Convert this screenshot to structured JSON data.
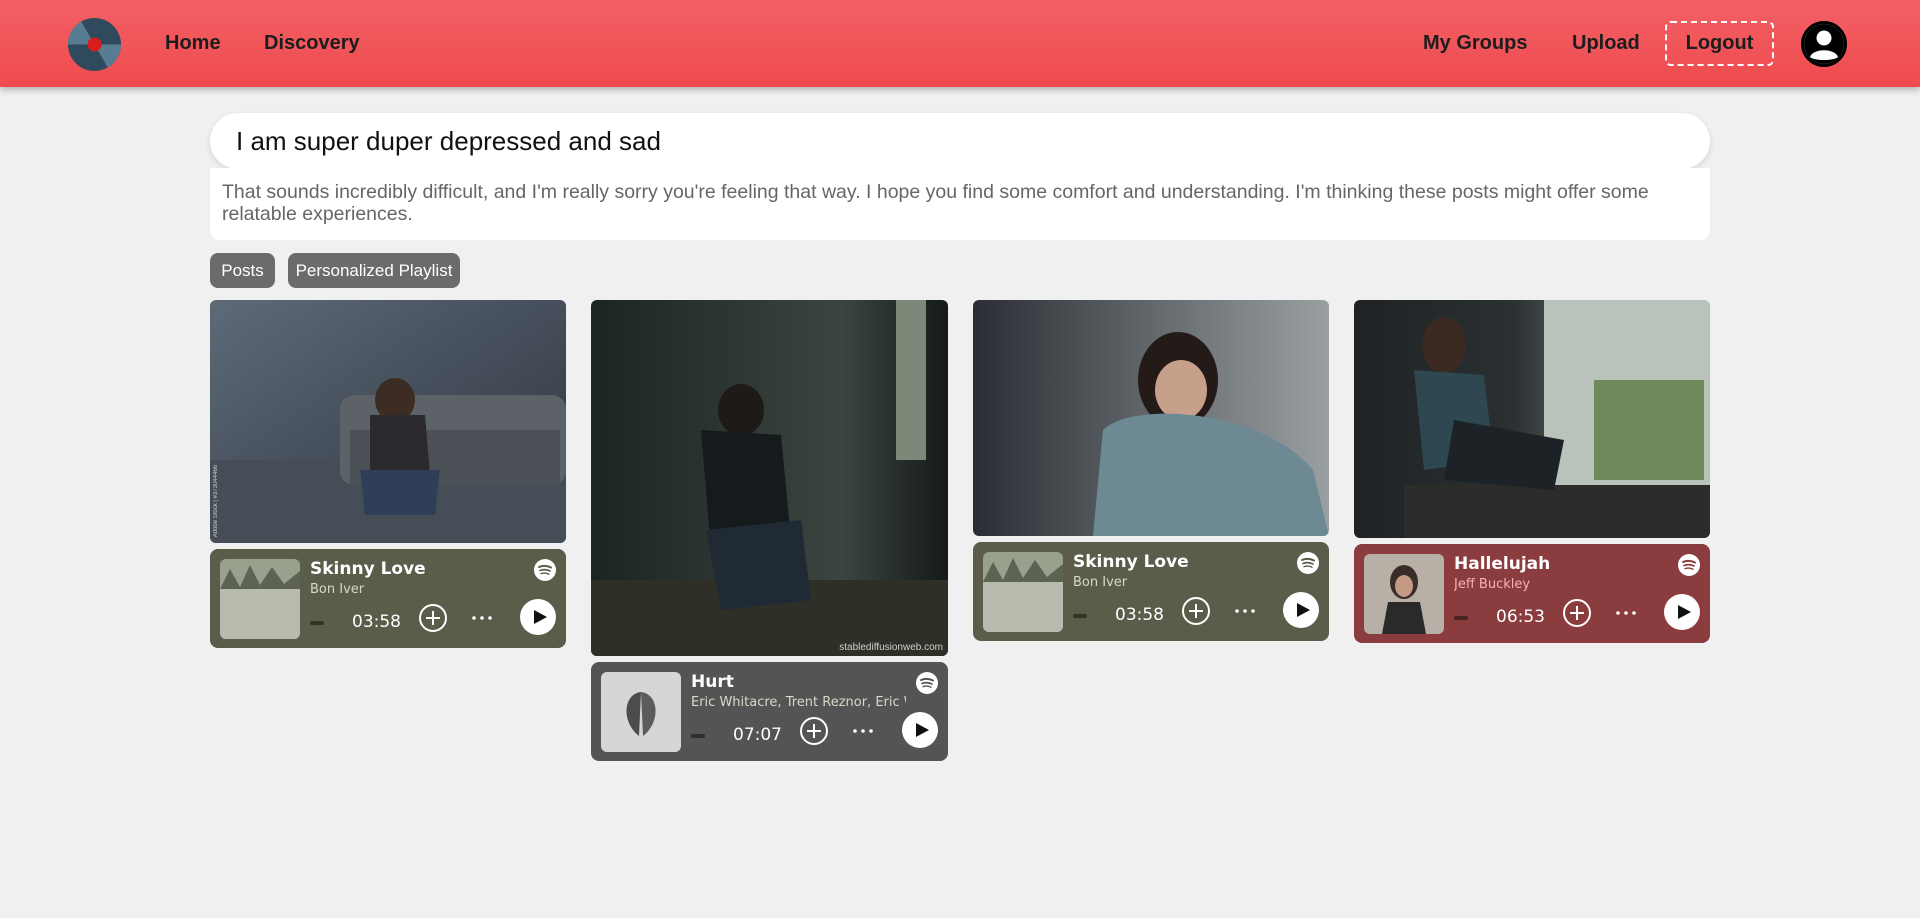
{
  "nav": {
    "home": "Home",
    "discovery": "Discovery",
    "my_groups": "My Groups",
    "upload": "Upload",
    "logout": "Logout"
  },
  "search": {
    "value": "I am super duper depressed and sad"
  },
  "response": {
    "text": "That sounds incredibly difficult, and I'm really sorry you're feeling that way. I hope you find some comfort and understanding. I'm thinking these posts might offer some relatable experiences."
  },
  "tabs": [
    {
      "label": "Posts"
    },
    {
      "label": "Personalized Playlist"
    }
  ],
  "posts": [
    {
      "image_watermark": "Adobe Stock | #373044466",
      "song": {
        "title": "Skinny Love",
        "artist": "Bon Iver",
        "duration": "03:58",
        "color": "#5c5c4b"
      }
    },
    {
      "image_watermark": "stablediffusionweb.com",
      "song": {
        "title": "Hurt",
        "artist": "Eric Whitacre, Trent Reznor, Eric Whitacre",
        "duration": "07:07",
        "color": "#545454"
      }
    },
    {
      "image_watermark": "",
      "song": {
        "title": "Skinny Love",
        "artist": "Bon Iver",
        "duration": "03:58",
        "color": "#5c5c4b"
      }
    },
    {
      "image_watermark": "",
      "song": {
        "title": "Hallelujah",
        "artist": "Jeff Buckley",
        "duration": "06:53",
        "color": "#8a3c3e"
      }
    }
  ],
  "colors": {
    "navbar": "#ef4b4e",
    "background": "#f0f0f0",
    "tab": "#6b6b6b"
  },
  "icons": {
    "logo": "vinyl-record-icon",
    "avatar": "user-circle-icon",
    "spotify": "spotify-icon",
    "add": "plus-circle-icon",
    "more": "more-horizontal-icon",
    "play": "play-icon"
  }
}
